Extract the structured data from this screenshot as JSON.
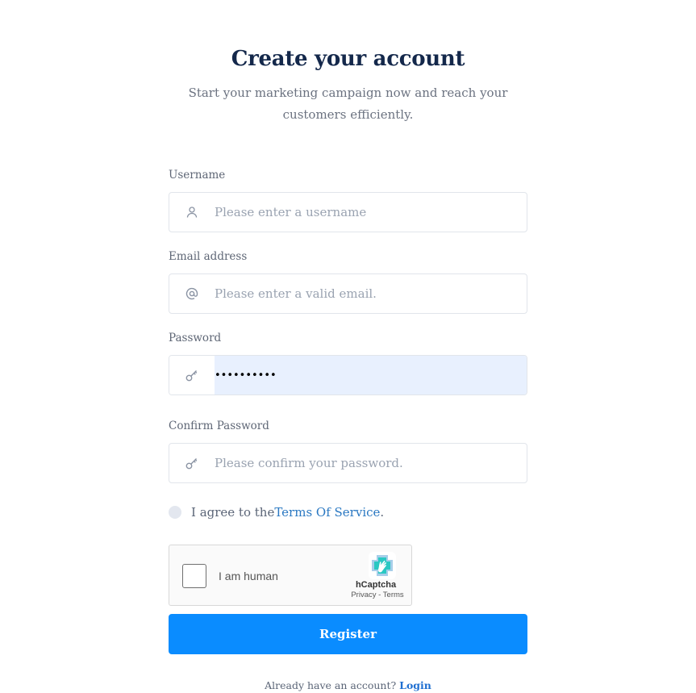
{
  "header": {
    "title": "Create your account",
    "subtitle": "Start your marketing campaign now and reach your customers efficiently."
  },
  "form": {
    "username": {
      "label": "Username",
      "placeholder": "Please enter a username",
      "icon": "user-icon"
    },
    "email": {
      "label": "Email address",
      "placeholder": "Please enter a valid email.",
      "icon": "at-icon"
    },
    "password": {
      "label": "Password",
      "value": "••••••••••",
      "icon": "key-icon"
    },
    "confirm_password": {
      "label": "Confirm Password",
      "placeholder": "Please confirm your password.",
      "icon": "key-icon"
    },
    "agree": {
      "prefix": "I agree to the ",
      "link": "Terms Of Service",
      "suffix": "."
    },
    "captcha": {
      "label": "I am human",
      "brand": "hCaptcha",
      "privacy": "Privacy",
      "sep": " - ",
      "terms": "Terms"
    },
    "submit_label": "Register"
  },
  "footer": {
    "text": "Already have an account? ",
    "link": "Login"
  },
  "colors": {
    "title": "#14284b",
    "accent": "#0a8cff",
    "link": "#2a78c2",
    "autofill_bg": "#e8f0fe"
  }
}
